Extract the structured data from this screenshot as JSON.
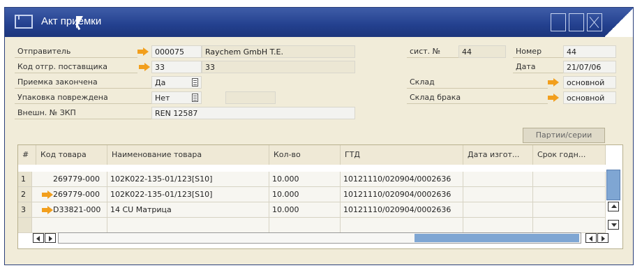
{
  "window": {
    "title": "Акт приемки"
  },
  "header": {
    "sender_label": "Отправитель",
    "sender_code": "000075",
    "sender_name": "Raychem GmbH T.E.",
    "supplier_code_label": "Код отгр. поставщика",
    "supplier_code": "33",
    "supplier_code2": "33",
    "receipt_done_label": "Приемка закончена",
    "receipt_done_value": "Да",
    "package_damaged_label": "Упаковка повреждена",
    "package_damaged_value": "Нет",
    "ext_no_label": "Внешн. № ЗКП",
    "ext_no_value": "REN 12587",
    "sys_no_label": "сист. №",
    "sys_no_value": "44",
    "number_label": "Номер",
    "number_value": "44",
    "date_label": "Дата",
    "date_value": "21/07/06",
    "warehouse_label": "Склад",
    "warehouse_value": "основной",
    "defect_warehouse_label": "Склад брака",
    "defect_warehouse_value": "основной"
  },
  "buttons": {
    "batches": "Партии/серии"
  },
  "table": {
    "columns": [
      "#",
      "Код товара",
      "Наименование товара",
      "Кол-во",
      "ГТД",
      "Дата изгот...",
      "Срок годн..."
    ],
    "rows": [
      [
        "1",
        "269779-000",
        "102K022-135-01/123[S10]",
        "10.000",
        "10121110/020904/0002636",
        "",
        ""
      ],
      [
        "2",
        "269779-000",
        "102K022-135-01/123[S10]",
        "10.000",
        "10121110/020904/0002636",
        "",
        ""
      ],
      [
        "3",
        "D33821-000",
        "14 CU Матрица",
        "10.000",
        "10121110/020904/0002636",
        "",
        ""
      ]
    ]
  },
  "icons": {
    "title": "document-icon",
    "link": "orange-arrow-icon",
    "dropdown": "list-icon"
  },
  "colors": {
    "titlebar": "#23408e",
    "accent": "#f29f1d",
    "window_bg": "#f1ecd9",
    "scroll": "#7fa6d3"
  }
}
